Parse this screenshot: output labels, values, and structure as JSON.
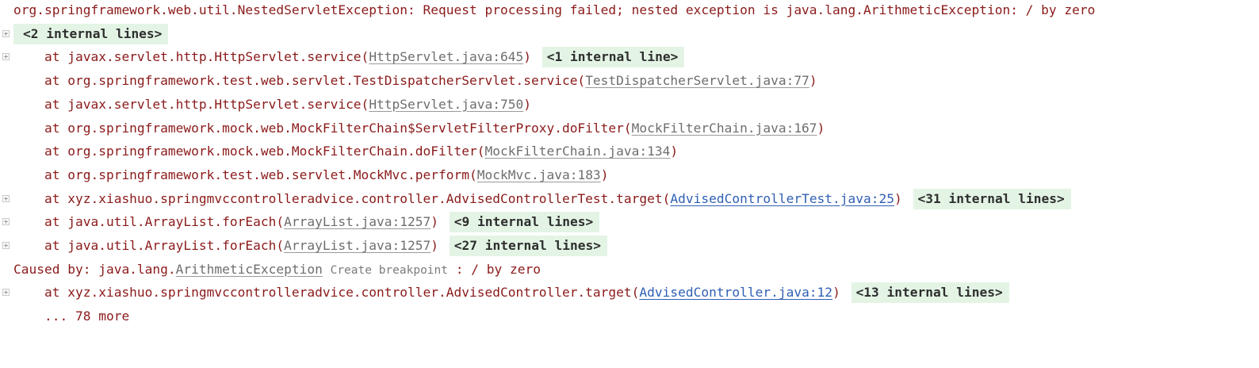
{
  "console": {
    "header": {
      "text": "org.springframework.web.util.NestedServletException: Request processing failed; nested exception is java.lang.ArithmeticException: / by zero"
    },
    "fold_internal_2": "<2 internal lines>",
    "frames": [
      {
        "prefix": "    at javax.servlet.http.HttpServlet.service(",
        "link": "HttpServlet.java:645",
        "suffix": ")",
        "fold": "<1 internal line>"
      },
      {
        "prefix": "    at org.springframework.test.web.servlet.TestDispatcherServlet.service(",
        "link": "TestDispatcherServlet.java:77",
        "suffix": ")"
      },
      {
        "prefix": "    at javax.servlet.http.HttpServlet.service(",
        "link": "HttpServlet.java:750",
        "suffix": ")"
      },
      {
        "prefix": "    at org.springframework.mock.web.MockFilterChain$ServletFilterProxy.doFilter(",
        "link": "MockFilterChain.java:167",
        "suffix": ")"
      },
      {
        "prefix": "    at org.springframework.mock.web.MockFilterChain.doFilter(",
        "link": "MockFilterChain.java:134",
        "suffix": ")"
      },
      {
        "prefix": "    at org.springframework.test.web.servlet.MockMvc.perform(",
        "link": "MockMvc.java:183",
        "suffix": ")"
      },
      {
        "prefix": "    at xyz.xiashuo.springmvccontrolleradvice.controller.AdvisedControllerTest.target(",
        "link": "AdvisedControllerTest.java:25",
        "suffix": ")",
        "fold": "<31 internal lines>"
      },
      {
        "prefix": "    at java.util.ArrayList.forEach(",
        "link": "ArrayList.java:1257",
        "suffix": ")",
        "fold": "<9 internal lines>"
      },
      {
        "prefix": "    at java.util.ArrayList.forEach(",
        "link": "ArrayList.java:1257",
        "suffix": ")",
        "fold": "<27 internal lines>"
      }
    ],
    "caused_by": {
      "prefix": "Caused by: java.lang.",
      "link": "ArithmeticException",
      "hint": "Create breakpoint",
      "suffix": " : / by zero"
    },
    "cause_frame": {
      "prefix": "    at xyz.xiashuo.springmvccontrolleradvice.controller.AdvisedController.target(",
      "link": "AdvisedController.java:12",
      "suffix": ")",
      "fold": "<13 internal lines>"
    },
    "more": "    ... 78 more"
  },
  "colors": {
    "error_text": "#8b1a1a",
    "fold_background": "#e3f4e5",
    "project_link": "#2f5fb5",
    "library_link": "#6e6e6e"
  }
}
